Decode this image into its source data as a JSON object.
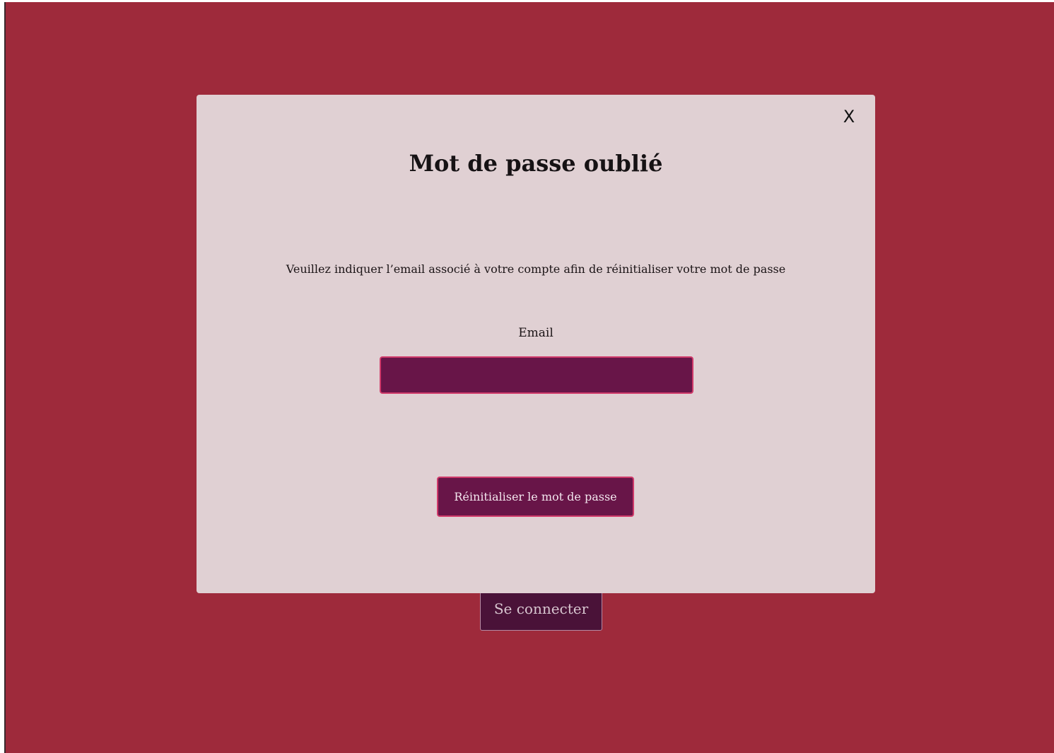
{
  "colors": {
    "page_background": "#9e2a3b",
    "modal_background": "#e0d0d3",
    "button_background": "#681548",
    "button_border": "#d03a6a",
    "login_button_background": "#4a1238"
  },
  "background": {
    "login_button_label": "Se connecter"
  },
  "modal": {
    "close_label": "X",
    "title": "Mot de passe oublié",
    "instructions": "Veuillez indiquer l’email associé à votre compte afin de réinitialiser votre mot de passe",
    "email_label": "Email",
    "email_value": "",
    "reset_button_label": "Réinitialiser le mot de passe"
  }
}
